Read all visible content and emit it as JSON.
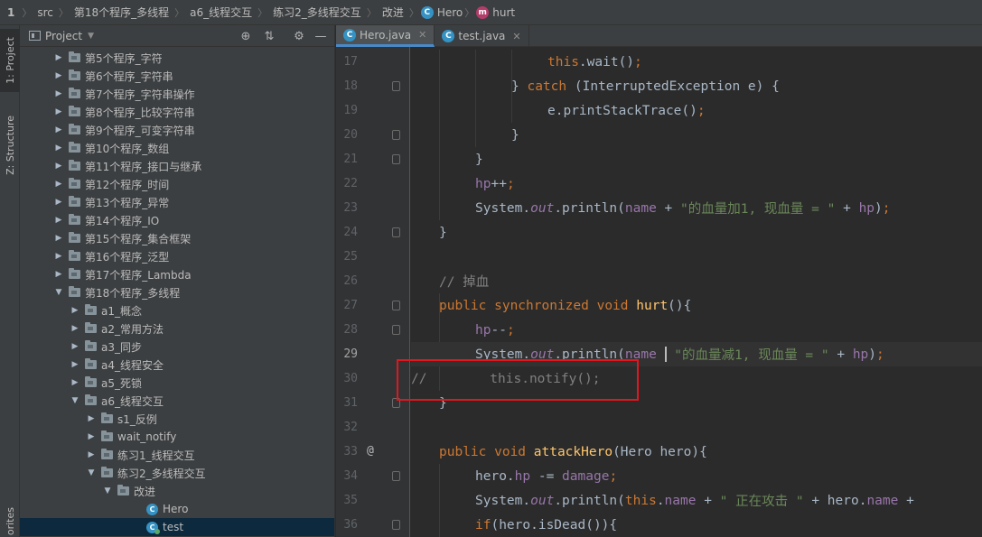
{
  "breadcrumb": {
    "project_num": "1",
    "items": [
      "src",
      "第18个程序_多线程",
      "a6_线程交互",
      "练习2_多线程交互",
      "改进",
      "Hero",
      "hurt"
    ]
  },
  "tool_strip": {
    "project_tab": "1: Project",
    "structure_tab": "Z: Structure",
    "favorites_tab": "orites"
  },
  "project_panel": {
    "title": "Project",
    "tree": [
      {
        "label": "第5个程序_字符",
        "depth": 0,
        "type": "folder",
        "expanded": false
      },
      {
        "label": "第6个程序_字符串",
        "depth": 0,
        "type": "folder",
        "expanded": false
      },
      {
        "label": "第7个程序_字符串操作",
        "depth": 0,
        "type": "folder",
        "expanded": false
      },
      {
        "label": "第8个程序_比较字符串",
        "depth": 0,
        "type": "folder",
        "expanded": false
      },
      {
        "label": "第9个程序_可变字符串",
        "depth": 0,
        "type": "folder",
        "expanded": false
      },
      {
        "label": "第10个程序_数组",
        "depth": 0,
        "type": "folder",
        "expanded": false
      },
      {
        "label": "第11个程序_接口与继承",
        "depth": 0,
        "type": "folder",
        "expanded": false
      },
      {
        "label": "第12个程序_时间",
        "depth": 0,
        "type": "folder",
        "expanded": false
      },
      {
        "label": "第13个程序_异常",
        "depth": 0,
        "type": "folder",
        "expanded": false
      },
      {
        "label": "第14个程序_IO",
        "depth": 0,
        "type": "folder",
        "expanded": false
      },
      {
        "label": "第15个程序_集合框架",
        "depth": 0,
        "type": "folder",
        "expanded": false
      },
      {
        "label": "第16个程序_泛型",
        "depth": 0,
        "type": "folder",
        "expanded": false
      },
      {
        "label": "第17个程序_Lambda",
        "depth": 0,
        "type": "folder",
        "expanded": false
      },
      {
        "label": "第18个程序_多线程",
        "depth": 0,
        "type": "folder",
        "expanded": true
      },
      {
        "label": "a1_概念",
        "depth": 1,
        "type": "folder",
        "expanded": false
      },
      {
        "label": "a2_常用方法",
        "depth": 1,
        "type": "folder",
        "expanded": false
      },
      {
        "label": "a3_同步",
        "depth": 1,
        "type": "folder",
        "expanded": false
      },
      {
        "label": "a4_线程安全",
        "depth": 1,
        "type": "folder",
        "expanded": false
      },
      {
        "label": "a5_死锁",
        "depth": 1,
        "type": "folder",
        "expanded": false
      },
      {
        "label": "a6_线程交互",
        "depth": 1,
        "type": "folder",
        "expanded": true
      },
      {
        "label": "s1_反例",
        "depth": 2,
        "type": "folder",
        "expanded": false
      },
      {
        "label": "wait_notify",
        "depth": 2,
        "type": "folder",
        "expanded": false
      },
      {
        "label": "练习1_线程交互",
        "depth": 2,
        "type": "folder",
        "expanded": false
      },
      {
        "label": "练习2_多线程交互",
        "depth": 2,
        "type": "folder",
        "expanded": true
      },
      {
        "label": "改进",
        "depth": 3,
        "type": "folder",
        "expanded": true
      },
      {
        "label": "Hero",
        "depth": 4,
        "type": "class",
        "expanded": null
      },
      {
        "label": "test",
        "depth": 4,
        "type": "runnable",
        "expanded": null,
        "selected": true
      }
    ]
  },
  "editor": {
    "tabs": [
      {
        "label": "Hero.java",
        "active": true
      },
      {
        "label": "test.java",
        "active": false
      }
    ],
    "current_line": 29,
    "lines": [
      {
        "num": "17",
        "indent": 3,
        "tokens": [
          [
            "kw",
            "this"
          ],
          [
            "plain",
            "."
          ],
          [
            "plain",
            "wait"
          ],
          [
            "plain",
            "()"
          ],
          [
            "kw",
            ";"
          ]
        ]
      },
      {
        "num": "18",
        "indent": 2,
        "tokens": [
          [
            "plain",
            "} "
          ],
          [
            "kw",
            "catch"
          ],
          [
            "plain",
            " (InterruptedException e) {"
          ]
        ]
      },
      {
        "num": "19",
        "indent": 3,
        "tokens": [
          [
            "plain",
            "e.printStackTrace()"
          ],
          [
            "kw",
            ";"
          ]
        ]
      },
      {
        "num": "20",
        "indent": 2,
        "tokens": [
          [
            "plain",
            "}"
          ]
        ]
      },
      {
        "num": "21",
        "indent": 1,
        "tokens": [
          [
            "plain",
            "}"
          ]
        ]
      },
      {
        "num": "22",
        "indent": 1,
        "tokens": [
          [
            "field",
            "hp"
          ],
          [
            "plain",
            "++"
          ],
          [
            "kw",
            ";"
          ]
        ]
      },
      {
        "num": "23",
        "indent": 1,
        "tokens": [
          [
            "plain",
            "System."
          ],
          [
            "static",
            "out"
          ],
          [
            "plain",
            ".println("
          ],
          [
            "field",
            "name"
          ],
          [
            "plain",
            " + "
          ],
          [
            "str",
            "\"的血量加1, 现血量 = \""
          ],
          [
            "plain",
            " + "
          ],
          [
            "field",
            "hp"
          ],
          [
            "plain",
            ")"
          ],
          [
            "kw",
            ";"
          ]
        ]
      },
      {
        "num": "24",
        "indent": 0,
        "tokens": [
          [
            "plain",
            "}"
          ]
        ]
      },
      {
        "num": "25",
        "indent": 0,
        "tokens": []
      },
      {
        "num": "26",
        "indent": 0,
        "tokens": [
          [
            "cmt",
            "// 掉血"
          ]
        ]
      },
      {
        "num": "27",
        "indent": 0,
        "tokens": [
          [
            "kw",
            "public synchronized void "
          ],
          [
            "fn",
            "hurt"
          ],
          [
            "plain",
            "(){"
          ]
        ]
      },
      {
        "num": "28",
        "indent": 1,
        "tokens": [
          [
            "field",
            "hp"
          ],
          [
            "plain",
            "--"
          ],
          [
            "kw",
            ";"
          ]
        ]
      },
      {
        "num": "29",
        "indent": 1,
        "tokens": [
          [
            "plain",
            "System."
          ],
          [
            "static",
            "out"
          ],
          [
            "plain",
            ".println("
          ],
          [
            "field",
            "name"
          ],
          [
            "plain",
            " "
          ],
          [
            "caret",
            ""
          ],
          [
            "plain",
            " "
          ],
          [
            "str",
            "\"的血量减1, 现血量 = \""
          ],
          [
            "plain",
            " + "
          ],
          [
            "field",
            "hp"
          ],
          [
            "plain",
            ")"
          ],
          [
            "kw",
            ";"
          ]
        ]
      },
      {
        "num": "30",
        "indent": -1,
        "tokens": [
          [
            "cmt",
            "//        this.notify();"
          ]
        ]
      },
      {
        "num": "31",
        "indent": 0,
        "tokens": [
          [
            "plain",
            "}"
          ]
        ]
      },
      {
        "num": "32",
        "indent": 0,
        "tokens": []
      },
      {
        "num": "33",
        "indent": 0,
        "override": true,
        "tokens": [
          [
            "kw",
            "public void "
          ],
          [
            "fn",
            "attackHero"
          ],
          [
            "plain",
            "(Hero hero){"
          ]
        ]
      },
      {
        "num": "34",
        "indent": 1,
        "tokens": [
          [
            "plain",
            "hero."
          ],
          [
            "field",
            "hp"
          ],
          [
            "plain",
            " -= "
          ],
          [
            "field",
            "damage"
          ],
          [
            "kw",
            ";"
          ]
        ]
      },
      {
        "num": "35",
        "indent": 1,
        "tokens": [
          [
            "plain",
            "System."
          ],
          [
            "static",
            "out"
          ],
          [
            "plain",
            ".println("
          ],
          [
            "kw",
            "this"
          ],
          [
            "plain",
            "."
          ],
          [
            "field",
            "name"
          ],
          [
            "plain",
            " + "
          ],
          [
            "str",
            "\" 正在攻击 \""
          ],
          [
            "plain",
            " + hero."
          ],
          [
            "field",
            "name"
          ],
          [
            "plain",
            " +"
          ]
        ]
      },
      {
        "num": "36",
        "indent": 1,
        "tokens": [
          [
            "kw",
            "if"
          ],
          [
            "plain",
            "(hero.isDead()){"
          ]
        ]
      }
    ]
  },
  "colors": {
    "keyword": "#cc7832",
    "function": "#ffc66d",
    "string": "#6a8759",
    "field": "#9876aa",
    "comment": "#808080",
    "highlight_box": "#e3161e"
  }
}
